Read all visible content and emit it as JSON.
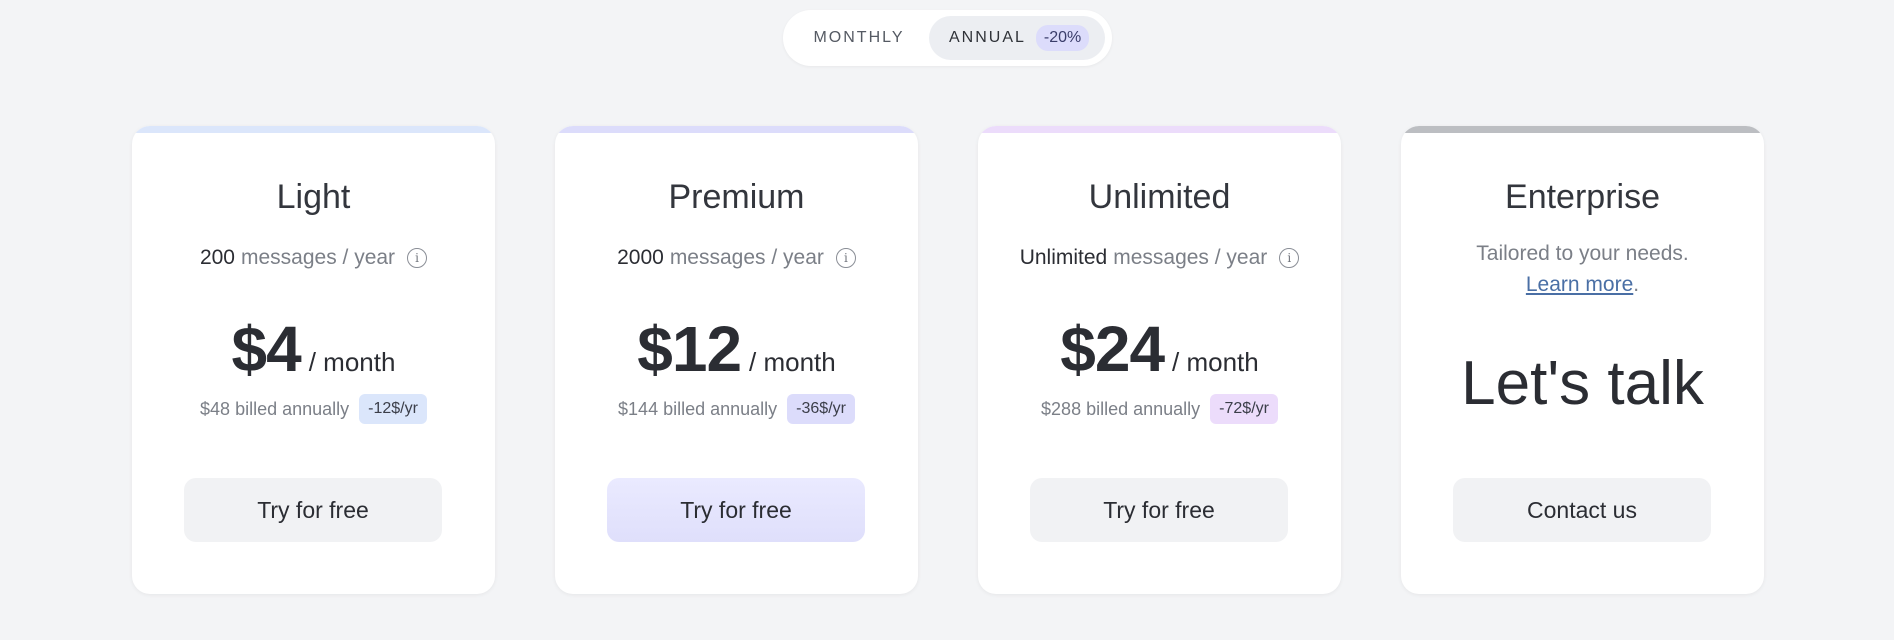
{
  "billing_toggle": {
    "monthly_label": "MONTHLY",
    "annual_label": "ANNUAL",
    "annual_discount": "-20%",
    "selected": "annual"
  },
  "plans": [
    {
      "name": "Light",
      "message_qty": "200",
      "message_unit": "messages / year",
      "price": "$4",
      "period": "/ month",
      "billed": "$48 billed annually",
      "saving": "-12$/yr",
      "cta": "Try for free",
      "accent": "#dbe6fb",
      "badge_bg": "#dbe6fb"
    },
    {
      "name": "Premium",
      "message_qty": "2000",
      "message_unit": "messages / year",
      "price": "$12",
      "period": "/ month",
      "billed": "$144 billed annually",
      "saving": "-36$/yr",
      "cta": "Try for free",
      "accent": "#dcdcfb",
      "badge_bg": "#dcdcfb"
    },
    {
      "name": "Unlimited",
      "message_qty": "Unlimited",
      "message_unit": "messages / year",
      "price": "$24",
      "period": "/ month",
      "billed": "$288 billed annually",
      "saving": "-72$/yr",
      "cta": "Try for free",
      "accent": "#ecdcfb",
      "badge_bg": "#ecdcfb"
    }
  ],
  "enterprise": {
    "name": "Enterprise",
    "description": "Tailored to your needs.",
    "link_text": "Learn more",
    "link_suffix": ".",
    "headline": "Let's talk",
    "cta": "Contact us",
    "accent": "#bcbec2"
  },
  "icons": {
    "info": "info-icon"
  }
}
